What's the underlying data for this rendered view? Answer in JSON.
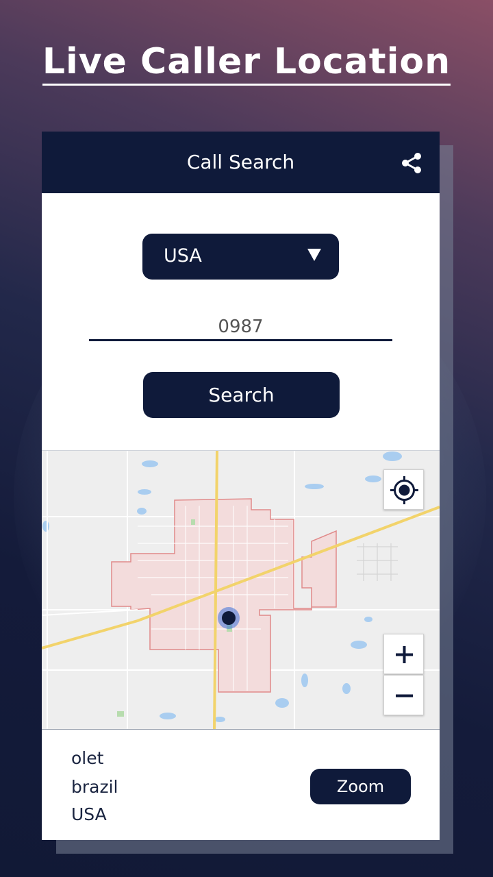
{
  "promo": {
    "title": "Live Caller Location"
  },
  "topbar": {
    "title": "Call Search",
    "share_icon": "share-icon"
  },
  "form": {
    "country_selected": "USA",
    "number_value": "0987",
    "search_label": "Search"
  },
  "map": {
    "locate_icon": "crosshair-icon",
    "zoom_in_label": "+",
    "zoom_out_label": "−"
  },
  "results": {
    "lines": [
      "olet",
      "brazil",
      "USA"
    ],
    "zoom_label": "Zoom"
  },
  "colors": {
    "primary": "#0f1a3a",
    "accent_marker": "#3a6fd8",
    "map_area_fill": "#f3d6d6",
    "map_area_border": "#e08a8a",
    "road_yellow": "#f2d36b"
  }
}
